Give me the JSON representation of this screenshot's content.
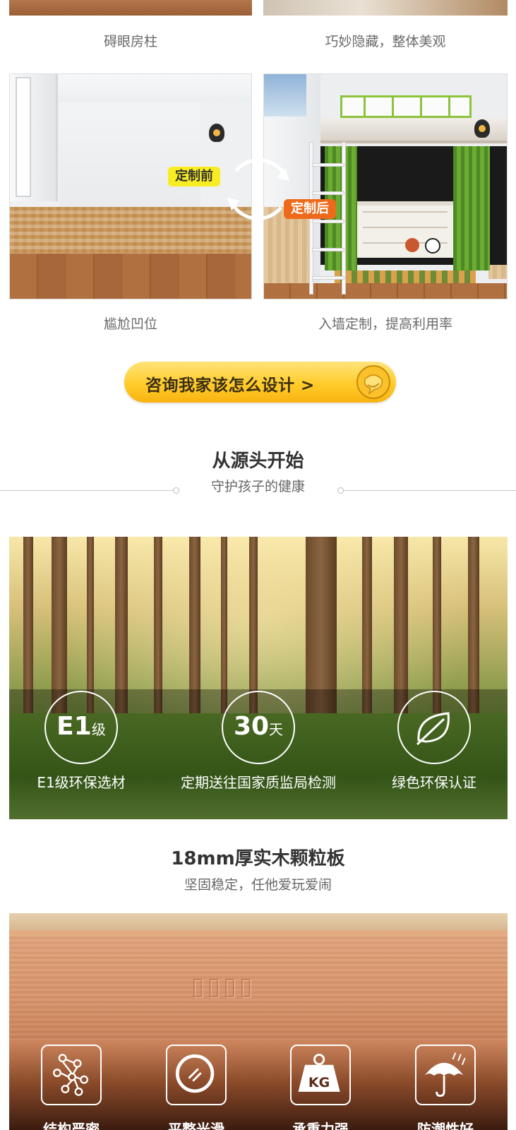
{
  "top_row": {
    "left_caption": "碍眼房柱",
    "right_caption": "巧妙隐藏，整体美观"
  },
  "compare_row": {
    "before_label": "定制前",
    "after_label": "定制后",
    "left_caption": "尴尬凹位",
    "right_caption": "入墙定制，提高利用率"
  },
  "cta": {
    "label": "咨询我家该怎么设计 >",
    "icon": "chat-bubble-icon",
    "color": "#ffcc2b"
  },
  "health_section": {
    "title": "从源头开始",
    "subtitle": "守护孩子的健康"
  },
  "forest_badges": [
    {
      "icon_text": "E1",
      "icon_suffix": "级",
      "label": "E1级环保选材"
    },
    {
      "icon_text": "30",
      "icon_suffix": "天",
      "label": "定期送往国家质监局检测"
    },
    {
      "icon": "leaf-icon",
      "label": "绿色环保认证"
    }
  ],
  "board_section": {
    "title": "18mm厚实木颗粒板",
    "subtitle": "坚固稳定，任他爱玩爱闹",
    "features": [
      {
        "icon": "molecule-structure-icon",
        "label": "结构严密"
      },
      {
        "icon": "smooth-surface-icon",
        "label": "平整光滑"
      },
      {
        "icon": "weight-kg-icon",
        "icon_text": "KG",
        "label": "承重力强"
      },
      {
        "icon": "umbrella-rain-icon",
        "label": "防潮性好"
      }
    ]
  }
}
